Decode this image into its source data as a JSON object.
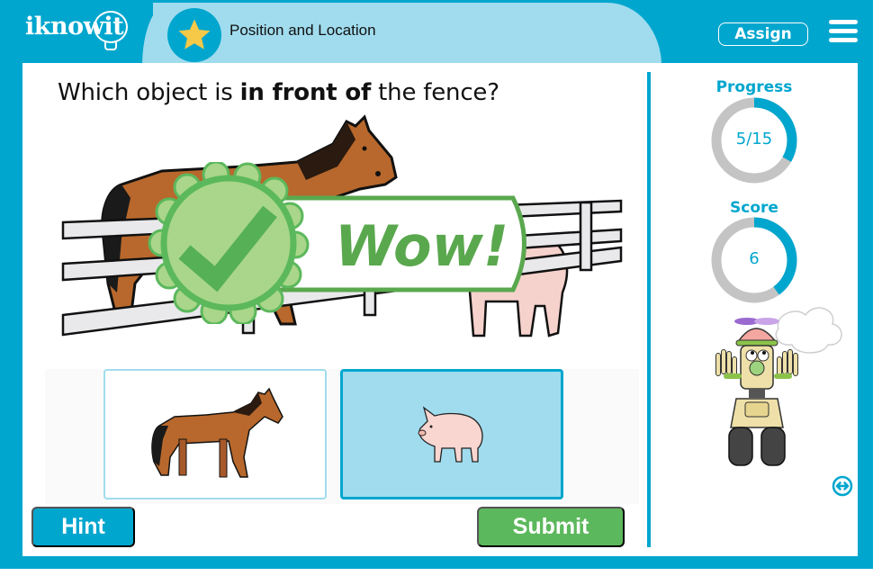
{
  "header": {
    "logo_text": "iknowit",
    "topic_title": "Position and Location",
    "topic_icon": "star-icon",
    "assign_label": "Assign",
    "menu_icon": "hamburger-menu-icon"
  },
  "question": {
    "prefix": "Which object is ",
    "emphasis": "in front of",
    "suffix": " the fence?"
  },
  "feedback": {
    "text": "Wow!",
    "icon": "checkmark-badge-icon"
  },
  "choices": [
    {
      "label": "horse",
      "icon": "horse-image",
      "selected": false
    },
    {
      "label": "pig",
      "icon": "pig-image",
      "selected": true
    }
  ],
  "buttons": {
    "hint_label": "Hint",
    "submit_label": "Submit"
  },
  "sidebar": {
    "progress_label": "Progress",
    "progress_text": "5/15",
    "progress_fraction": 0.3333,
    "score_label": "Score",
    "score_text": "6",
    "score_fraction": 0.4,
    "expand_icon": "expand-arrows-icon"
  },
  "colors": {
    "brand": "#00a6ce",
    "brand_light": "#a0dcee",
    "success": "#5cb85c",
    "ring_track": "#c4c4c4"
  }
}
